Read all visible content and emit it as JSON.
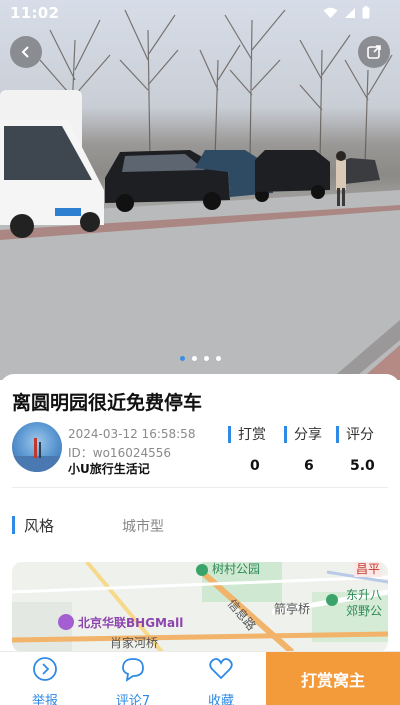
{
  "status_bar": {
    "time": "11:02"
  },
  "hero": {
    "carousel_count": 4,
    "active_index": 0
  },
  "spot": {
    "title": "离圆明园很近免费停车",
    "date": "2024-03-12 16:58:58",
    "id": "ID：wo16024556",
    "username": "小U旅行生活记"
  },
  "stats": [
    {
      "label": "打赏",
      "value": "0"
    },
    {
      "label": "分享",
      "value": "6"
    },
    {
      "label": "评分",
      "value": "5.0"
    }
  ],
  "style": {
    "label": "风格",
    "value": "城市型"
  },
  "map": {
    "labels": [
      "树村公园",
      "昌平",
      "东升八",
      "郊野公",
      "北京华联BHGMall",
      "箭亭桥",
      "肖家河桥",
      "信息路"
    ]
  },
  "bottom_bar": {
    "report": "举报",
    "comment": "评论7",
    "favorite": "收藏",
    "reward": "打赏窝主"
  },
  "colors": {
    "accent": "#2f8ae5",
    "reward": "#f39a3b"
  }
}
